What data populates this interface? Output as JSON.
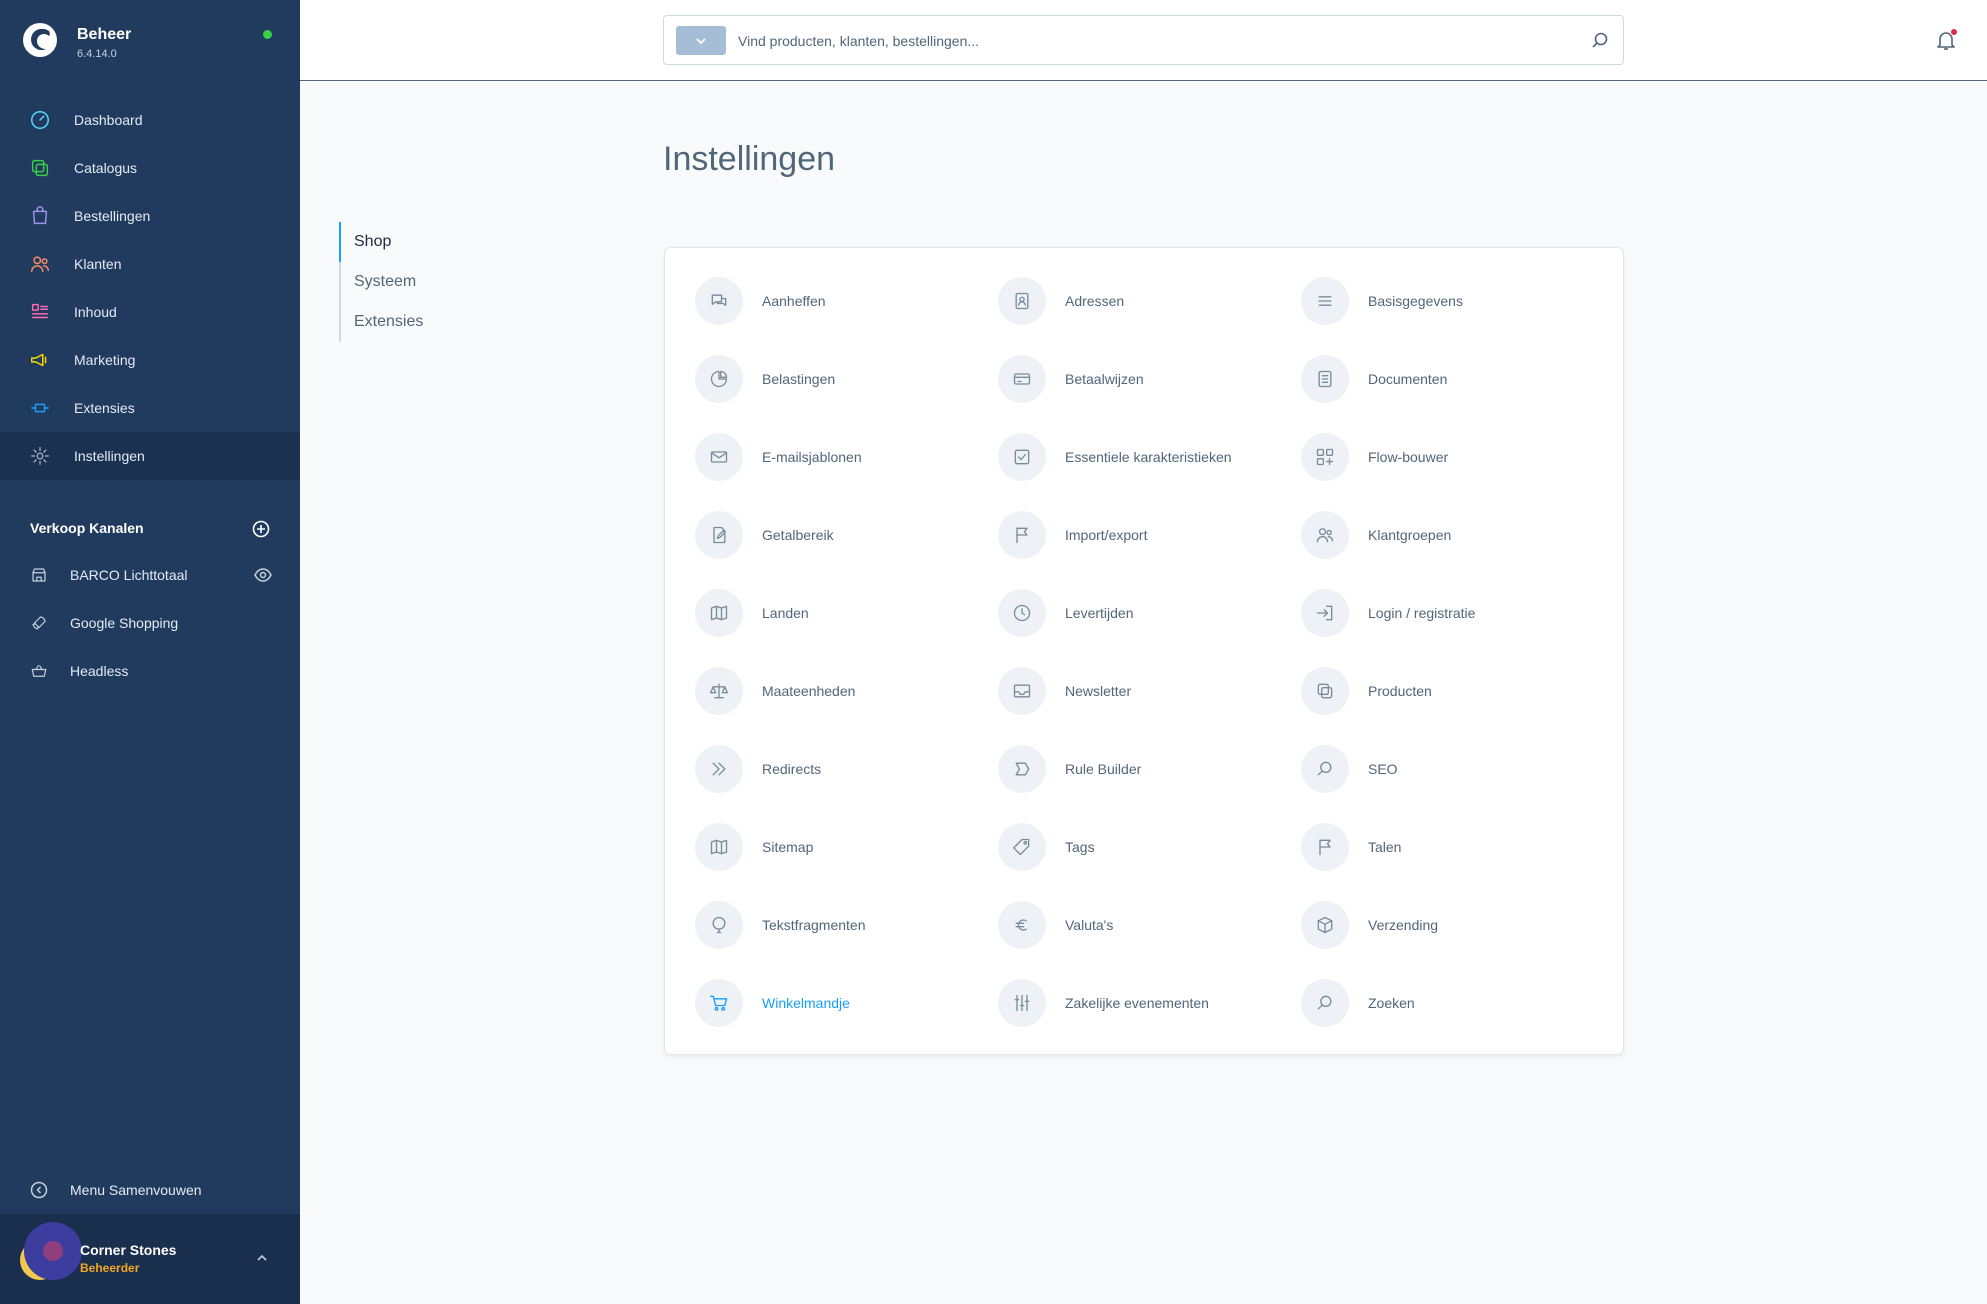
{
  "app": {
    "name": "Beheer",
    "version": "6.4.14.0"
  },
  "sidebar": {
    "items": [
      {
        "label": "Dashboard",
        "icon": "dashboard-icon",
        "color": "#57d9ff"
      },
      {
        "label": "Catalogus",
        "icon": "catalog-icon",
        "color": "#37d046"
      },
      {
        "label": "Bestellingen",
        "icon": "orders-icon",
        "color": "#a092f0"
      },
      {
        "label": "Klanten",
        "icon": "customers-icon",
        "color": "#f88962"
      },
      {
        "label": "Inhoud",
        "icon": "content-icon",
        "color": "#ff68b4"
      },
      {
        "label": "Marketing",
        "icon": "marketing-icon",
        "color": "#ffd700"
      },
      {
        "label": "Extensies",
        "icon": "extensions-icon",
        "color": "#189eff"
      },
      {
        "label": "Instellingen",
        "icon": "settings-icon",
        "color": "#9aa8b5"
      }
    ],
    "active_index": 7,
    "channels_title": "Verkoop Kanalen",
    "channels": [
      {
        "label": "BARCO Lichttotaal",
        "icon": "storefront-icon"
      },
      {
        "label": "Google Shopping",
        "icon": "rocket-icon"
      },
      {
        "label": "Headless",
        "icon": "basket-icon"
      }
    ],
    "collapse_label": "Menu Samenvouwen",
    "user": {
      "name": "Corner Stones",
      "role": "Beheerder"
    }
  },
  "search": {
    "placeholder": "Vind producten, klanten, bestellingen..."
  },
  "page": {
    "title": "Instellingen"
  },
  "tabs": [
    "Shop",
    "Systeem",
    "Extensies"
  ],
  "active_tab": 0,
  "settings": [
    {
      "label": "Aanheffen",
      "icon": "chat-icon"
    },
    {
      "label": "Adressen",
      "icon": "address-book-icon"
    },
    {
      "label": "Basisgegevens",
      "icon": "list-icon"
    },
    {
      "label": "Belastingen",
      "icon": "pie-chart-icon"
    },
    {
      "label": "Betaalwijzen",
      "icon": "credit-card-icon"
    },
    {
      "label": "Documenten",
      "icon": "document-icon"
    },
    {
      "label": "E-mailsjablonen",
      "icon": "envelope-icon"
    },
    {
      "label": "Essentiele karakteristieken",
      "icon": "checkbox-icon"
    },
    {
      "label": "Flow-bouwer",
      "icon": "flow-icon"
    },
    {
      "label": "Getalbereik",
      "icon": "edit-document-icon"
    },
    {
      "label": "Import/export",
      "icon": "flag-icon"
    },
    {
      "label": "Klantgroepen",
      "icon": "users-icon"
    },
    {
      "label": "Landen",
      "icon": "map-icon"
    },
    {
      "label": "Levertijden",
      "icon": "clock-icon"
    },
    {
      "label": "Login / registratie",
      "icon": "sign-in-icon"
    },
    {
      "label": "Maateenheden",
      "icon": "scale-icon"
    },
    {
      "label": "Newsletter",
      "icon": "inbox-icon"
    },
    {
      "label": "Producten",
      "icon": "products-icon"
    },
    {
      "label": "Redirects",
      "icon": "double-chevron-icon"
    },
    {
      "label": "Rule Builder",
      "icon": "rule-icon"
    },
    {
      "label": "SEO",
      "icon": "search-icon"
    },
    {
      "label": "Sitemap",
      "icon": "map-icon"
    },
    {
      "label": "Tags",
      "icon": "tag-icon"
    },
    {
      "label": "Talen",
      "icon": "flag-icon"
    },
    {
      "label": "Tekstfragmenten",
      "icon": "balloon-icon"
    },
    {
      "label": "Valuta's",
      "icon": "euro-icon"
    },
    {
      "label": "Verzending",
      "icon": "package-icon"
    },
    {
      "label": "Winkelmandje",
      "icon": "cart-icon"
    },
    {
      "label": "Zakelijke evenementen",
      "icon": "sliders-icon"
    },
    {
      "label": "Zoeken",
      "icon": "search-icon"
    }
  ],
  "active_setting": "Winkelmandje",
  "colors": {
    "accent": "#189eff",
    "sidebar_bg": "#213b5e",
    "notification": "#de294c"
  }
}
